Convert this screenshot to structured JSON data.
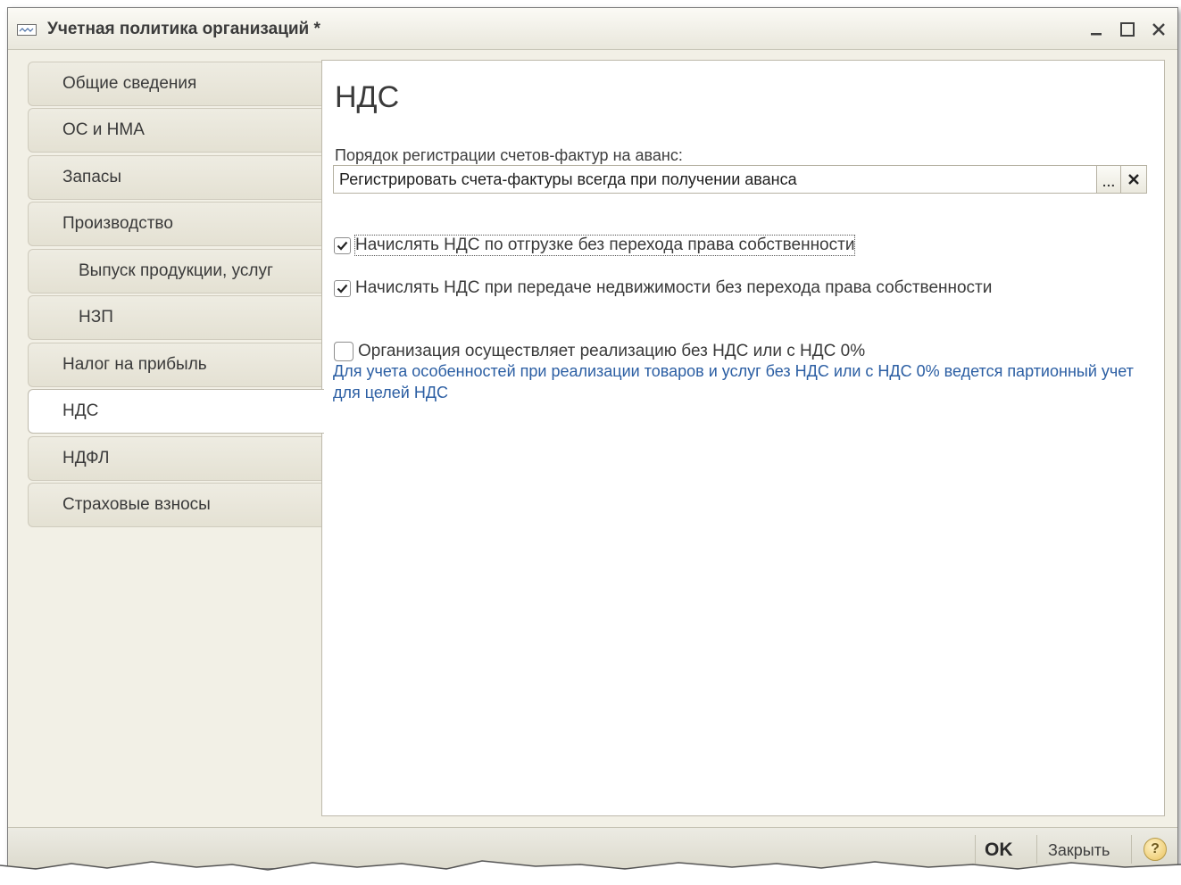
{
  "window": {
    "title": "Учетная политика организаций *",
    "controls": {
      "minimize": "_",
      "maximize": "☐",
      "close": "✕"
    }
  },
  "sidebar": {
    "items": [
      {
        "label": "Общие сведения",
        "active": false,
        "sub": false
      },
      {
        "label": "ОС и НМА",
        "active": false,
        "sub": false
      },
      {
        "label": "Запасы",
        "active": false,
        "sub": false
      },
      {
        "label": "Производство",
        "active": false,
        "sub": false
      },
      {
        "label": "Выпуск продукции, услуг",
        "active": false,
        "sub": true
      },
      {
        "label": "НЗП",
        "active": false,
        "sub": true
      },
      {
        "label": "Налог на прибыль",
        "active": false,
        "sub": false
      },
      {
        "label": "НДС",
        "active": true,
        "sub": false
      },
      {
        "label": "НДФЛ",
        "active": false,
        "sub": false
      },
      {
        "label": "Страховые взносы",
        "active": false,
        "sub": false
      }
    ]
  },
  "main": {
    "heading": "НДС",
    "invoice_order": {
      "label": "Порядок регистрации счетов-фактур на аванс:",
      "value": "Регистрировать счета-фактуры всегда при получении аванса",
      "select_button": "...",
      "clear_button": "✕"
    },
    "checkboxes": [
      {
        "label": "Начислять НДС по отгрузке без перехода права собственности",
        "checked": true
      },
      {
        "label": "Начислять НДС при передаче недвижимости без перехода права собственности",
        "checked": true
      },
      {
        "label": "Организация осуществляет реализацию без НДС или с НДС 0%",
        "checked": false
      }
    ],
    "info_text": "Для учета особенностей при реализации товаров и услуг без НДС или с НДС 0% ведется партионный учет для целей НДС"
  },
  "footer": {
    "ok_label": "OK",
    "close_label": "Закрыть",
    "help_label": "?"
  },
  "colors": {
    "panel_bg": "#f2f0e6",
    "content_bg": "#ffffff",
    "info_text": "#2b5ea3",
    "border": "#bdb9ab"
  }
}
